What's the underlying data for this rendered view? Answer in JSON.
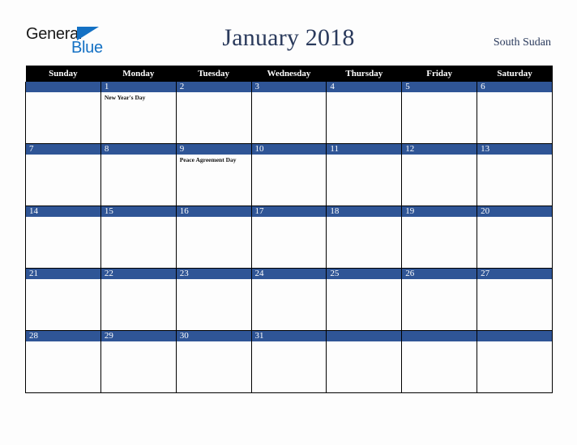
{
  "brand": {
    "name_part1": "General",
    "name_part2": "Blue",
    "triangle_icon": "blue-triangle-icon",
    "accent_color": "#1471c4"
  },
  "header": {
    "title": "January 2018",
    "country": "South Sudan",
    "title_color": "#2a3a5c"
  },
  "calendar": {
    "month": "January",
    "year": "2018",
    "weekday_headers": [
      "Sunday",
      "Monday",
      "Tuesday",
      "Wednesday",
      "Thursday",
      "Friday",
      "Saturday"
    ],
    "header_bg": "#000000",
    "daynum_bg": "#2f5596",
    "cell_bg": "#fdfdfd",
    "weeks": [
      [
        {
          "day": "",
          "events": []
        },
        {
          "day": "1",
          "events": [
            "New Year's Day"
          ]
        },
        {
          "day": "2",
          "events": []
        },
        {
          "day": "3",
          "events": []
        },
        {
          "day": "4",
          "events": []
        },
        {
          "day": "5",
          "events": []
        },
        {
          "day": "6",
          "events": []
        }
      ],
      [
        {
          "day": "7",
          "events": []
        },
        {
          "day": "8",
          "events": []
        },
        {
          "day": "9",
          "events": [
            "Peace Agreement Day"
          ]
        },
        {
          "day": "10",
          "events": []
        },
        {
          "day": "11",
          "events": []
        },
        {
          "day": "12",
          "events": []
        },
        {
          "day": "13",
          "events": []
        }
      ],
      [
        {
          "day": "14",
          "events": []
        },
        {
          "day": "15",
          "events": []
        },
        {
          "day": "16",
          "events": []
        },
        {
          "day": "17",
          "events": []
        },
        {
          "day": "18",
          "events": []
        },
        {
          "day": "19",
          "events": []
        },
        {
          "day": "20",
          "events": []
        }
      ],
      [
        {
          "day": "21",
          "events": []
        },
        {
          "day": "22",
          "events": []
        },
        {
          "day": "23",
          "events": []
        },
        {
          "day": "24",
          "events": []
        },
        {
          "day": "25",
          "events": []
        },
        {
          "day": "26",
          "events": []
        },
        {
          "day": "27",
          "events": []
        }
      ],
      [
        {
          "day": "28",
          "events": []
        },
        {
          "day": "29",
          "events": []
        },
        {
          "day": "30",
          "events": []
        },
        {
          "day": "31",
          "events": []
        },
        {
          "day": "",
          "events": []
        },
        {
          "day": "",
          "events": []
        },
        {
          "day": "",
          "events": []
        }
      ]
    ]
  }
}
